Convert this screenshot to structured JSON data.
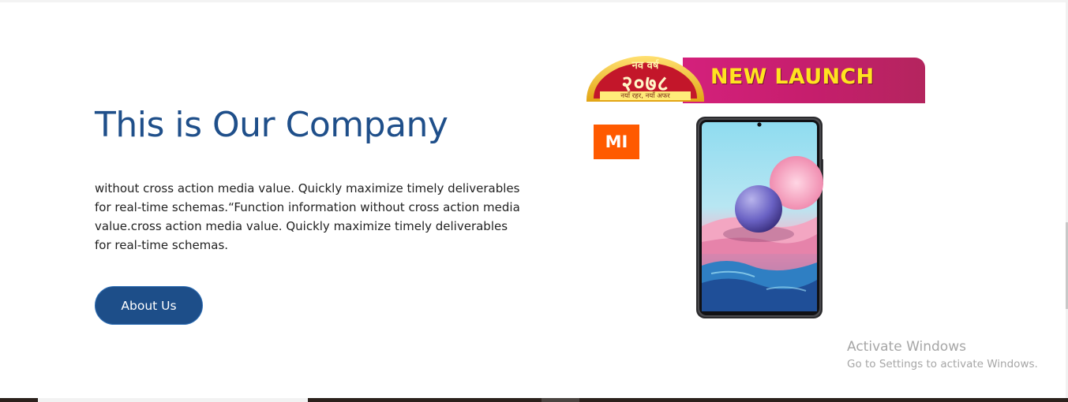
{
  "about_section": {
    "title": "This is Our Company",
    "description": "without cross action media value. Quickly maximize timely deliverables for real-time schemas.“Function information without cross action media value.cross action media value. Quickly maximize timely deliverables for real-time schemas.",
    "button_label": "About Us"
  },
  "banner": {
    "badge_top": "नव वर्ष",
    "badge_year": "२०७८",
    "badge_sub": "नयाँ रहर, नयाँ अफर",
    "headline": "NEW LAUNCH"
  },
  "brand_logo": {
    "text": "MI",
    "color": "#ff5a00"
  },
  "watermark": {
    "title": "Activate Windows",
    "subtitle": "Go to Settings to activate Windows."
  },
  "colors": {
    "heading": "#1f4f8a",
    "button_bg": "#1d4e89",
    "banner_ribbon": "#c51e6c",
    "banner_text": "#ffe320"
  }
}
